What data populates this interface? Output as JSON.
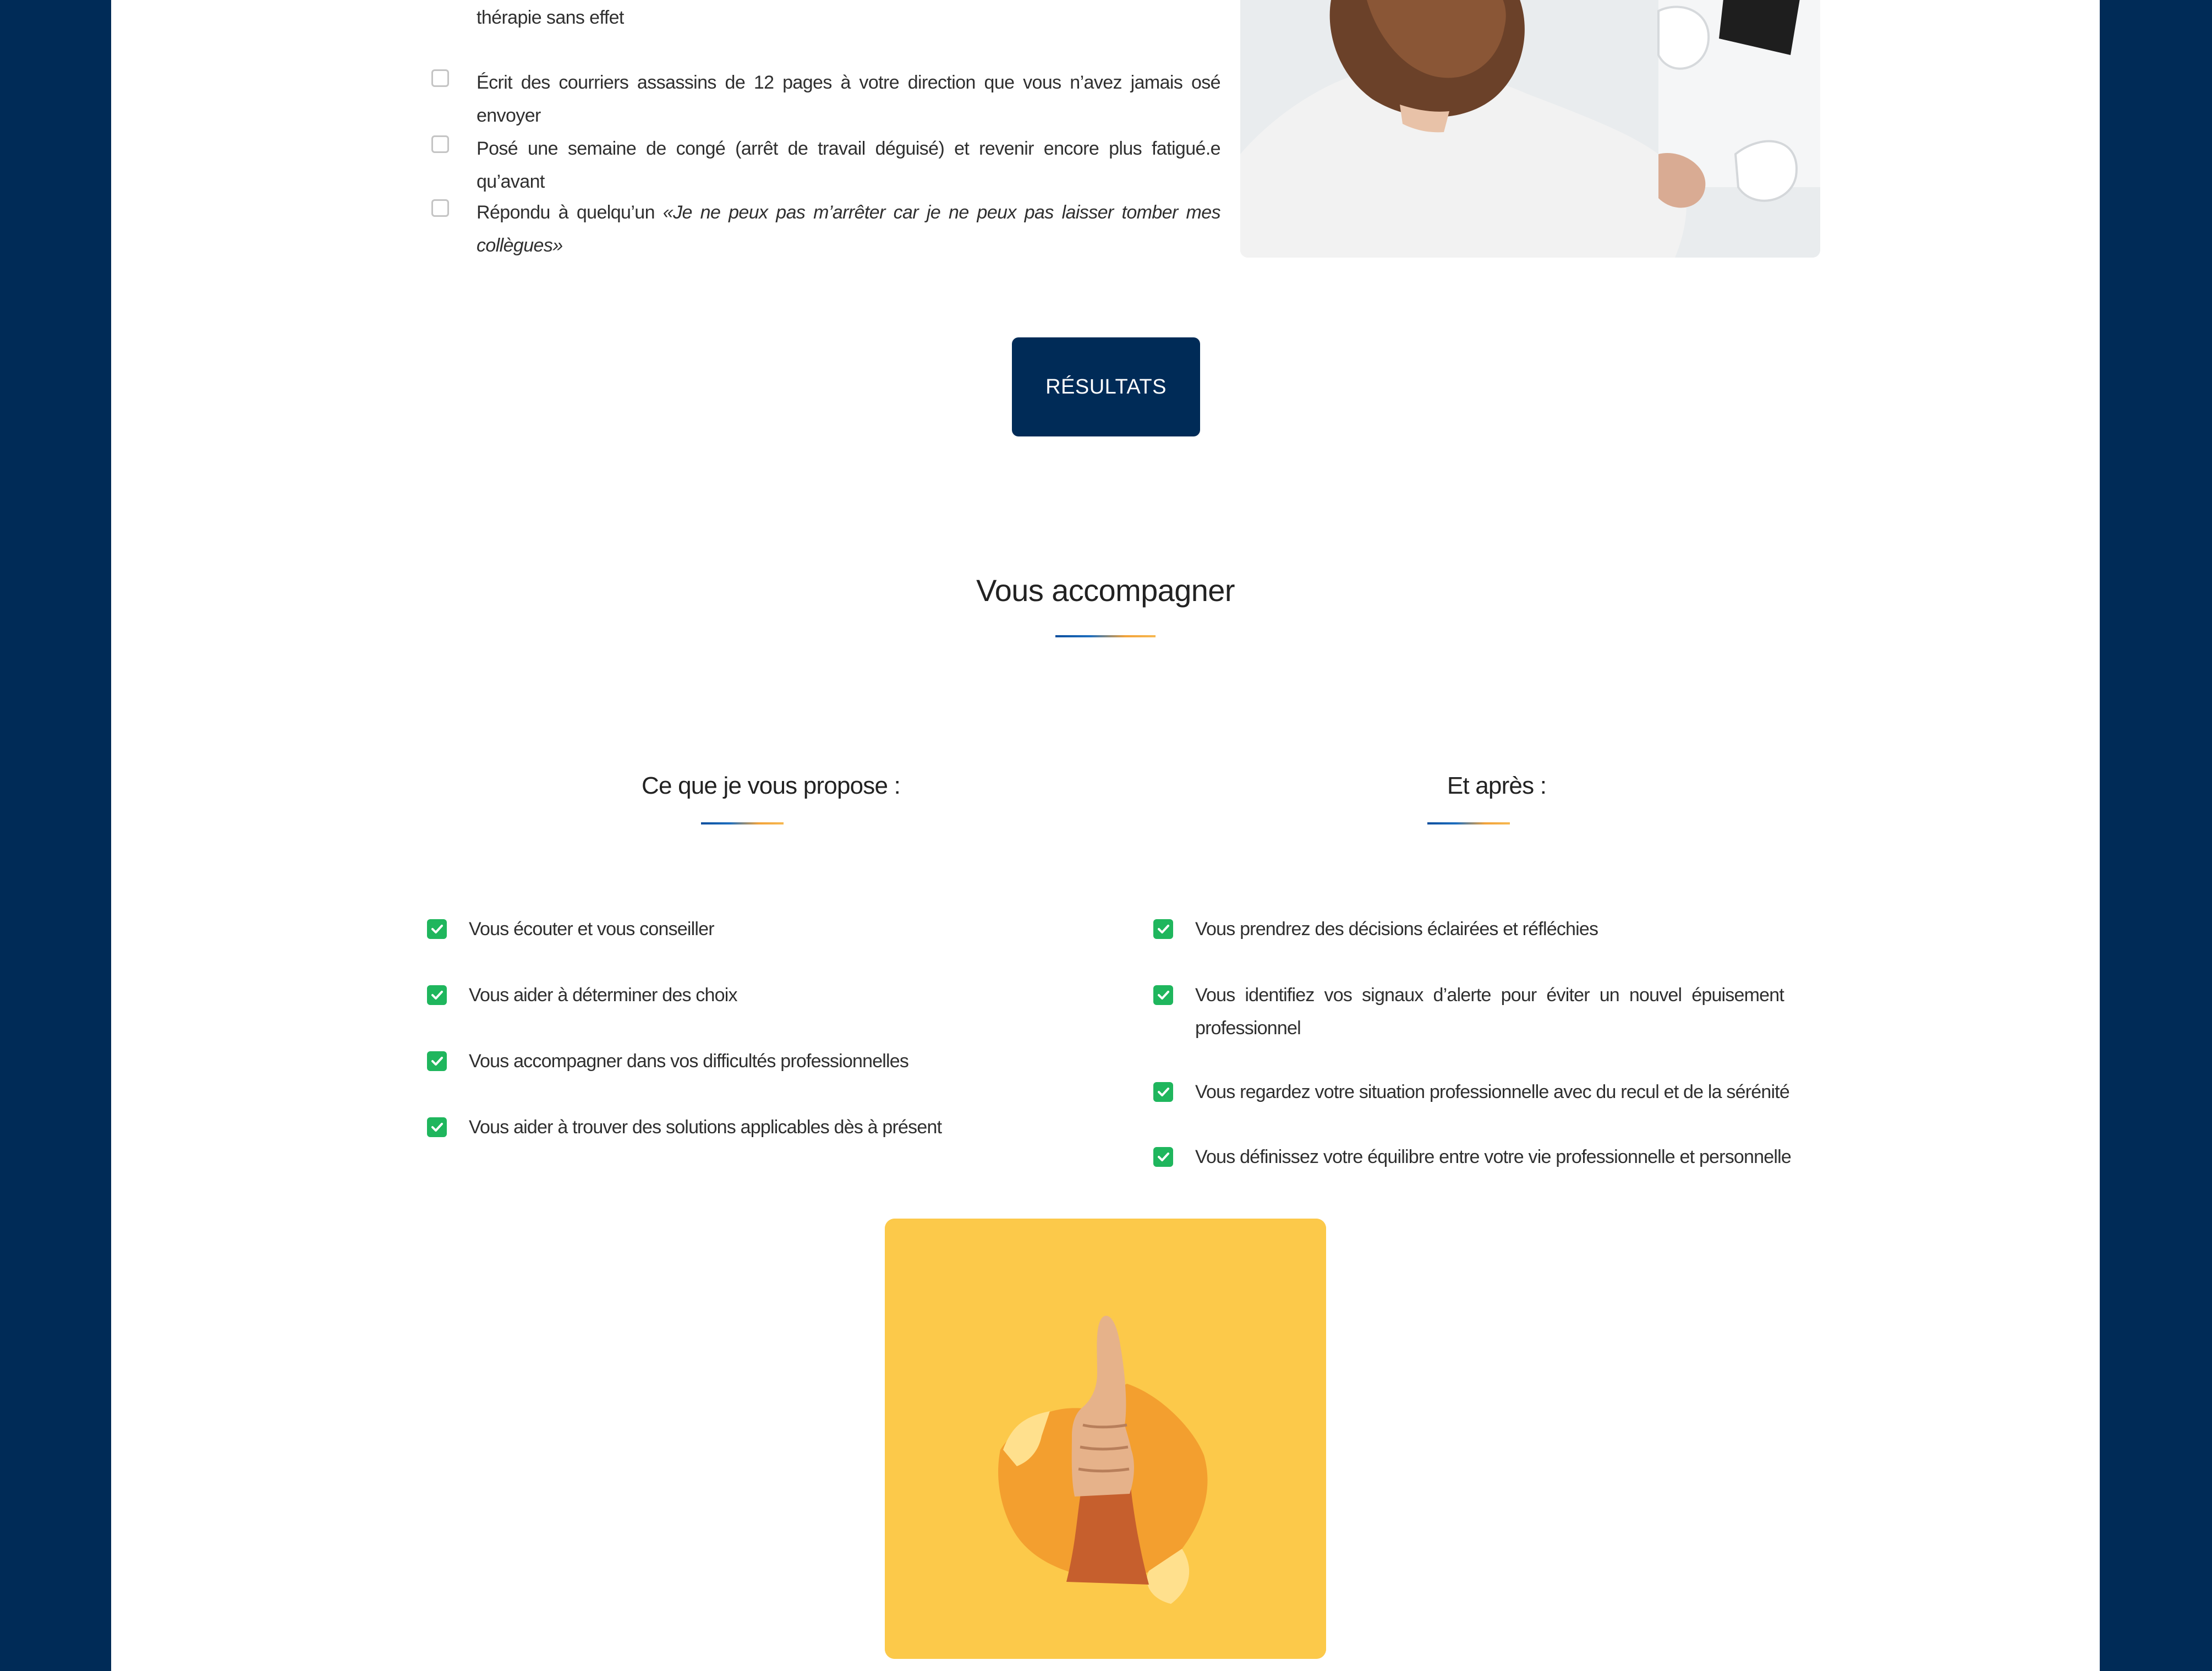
{
  "quiz": {
    "items": [
      {
        "text": "thérapie sans effet"
      },
      {
        "text": "Écrit des courriers assassins de 12 pages à votre direction que vous n’avez jamais osé envoyer"
      },
      {
        "text": "Posé une semaine de congé (arrêt de travail déguisé) et revenir encore plus fatigué.e qu’avant"
      },
      {
        "text_prefix": "Répondu à quelqu’un ",
        "quote": "«Je ne peux pas m’arrêter car je ne peux pas laisser tomber mes collègues»"
      }
    ],
    "results_button": "RÉSULTATS"
  },
  "accompany": {
    "title": "Vous accompagner",
    "left": {
      "heading": "Ce que je vous propose :",
      "items": [
        "Vous écouter et vous conseiller",
        "Vous aider à déterminer des choix",
        "Vous accompagner dans vos difficultés professionnelles",
        "Vous aider à trouver des solutions applicables dès à présent"
      ]
    },
    "right": {
      "heading": "Et après :",
      "items": [
        "Vous prendrez des décisions éclairées et réfléchies",
        "Vous identifiez vos signaux d’alerte pour éviter un nouvel épuisement professionnel",
        "Vous regardez votre situation professionnelle avec du recul et de la sérénité",
        "Vous définissez votre équilibre entre votre vie professionnelle et personnelle"
      ]
    }
  },
  "colors": {
    "navy": "#002b57",
    "check_green": "#1fb65d",
    "accent_blue": "#0b4f9e",
    "accent_orange": "#f3a33a",
    "photo_yellow": "#fcc94a"
  },
  "icons": [
    "checkbox-unchecked-icon",
    "check-icon"
  ]
}
